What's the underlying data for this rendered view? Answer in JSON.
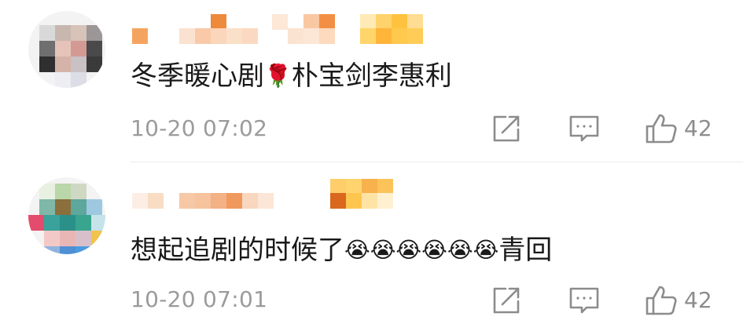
{
  "comments": [
    {
      "content_text": "冬季暖心剧",
      "content_emoji": "🌹",
      "content_tail": "朴宝剑李惠利",
      "timestamp": "10-20 07:02",
      "like_count": "42"
    },
    {
      "content_text": "想起追剧的时候了",
      "content_emoji": "😭😭😭😭😭😭",
      "content_tail": "青回",
      "timestamp": "10-20 07:01",
      "like_count": "42"
    }
  ],
  "icons": {
    "repost": "share-external-icon",
    "reply": "comment-bubble-icon",
    "like": "thumbs-up-icon"
  },
  "colors": {
    "meta_text": "#9b9b9b",
    "icon": "#8c8c8c",
    "divider": "#ececec"
  }
}
